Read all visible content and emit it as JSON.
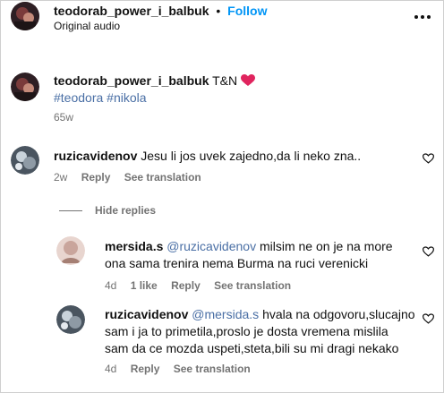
{
  "header": {
    "username": "teodorab_power_i_balbuk",
    "separator": "•",
    "follow_label": "Follow",
    "audio_label": "Original audio",
    "more_icon": "more-horizontal-icon"
  },
  "caption": {
    "username": "teodorab_power_i_balbuk",
    "text": "T&N",
    "emoji_icon": "red-heart-icon",
    "hashtags": "#teodora #nikola",
    "time": "65w"
  },
  "comments": [
    {
      "username": "ruzicavidenov",
      "text": "Jesu li jos uvek zajedno,da li neko zna..",
      "time": "2w",
      "reply_label": "Reply",
      "translation_label": "See translation"
    }
  ],
  "replies_toggle": {
    "label": "Hide replies"
  },
  "replies": [
    {
      "username": "mersida.s",
      "mention": "@ruzicavidenov",
      "text_line1": "milsim ne on je na more",
      "text_line2": "ona sama trenira nema Burma na ruci verenicki",
      "time": "4d",
      "likes": "1 like",
      "reply_label": "Reply",
      "translation_label": "See translation"
    },
    {
      "username": "ruzicavidenov",
      "mention": "@mersida.s",
      "text_line1": "hvala na odgovoru,slucajno",
      "text_line2": "sam i ja to primetila,proslo je dosta vremena mislila",
      "text_line3": "sam da ce mozda uspeti,steta,bili su mi dragi nekako",
      "time": "4d",
      "reply_label": "Reply",
      "translation_label": "See translation"
    }
  ],
  "colors": {
    "follow": "#0095f6",
    "mention": "#4a6fa5",
    "muted": "#737373",
    "heart": "#e0245e"
  }
}
